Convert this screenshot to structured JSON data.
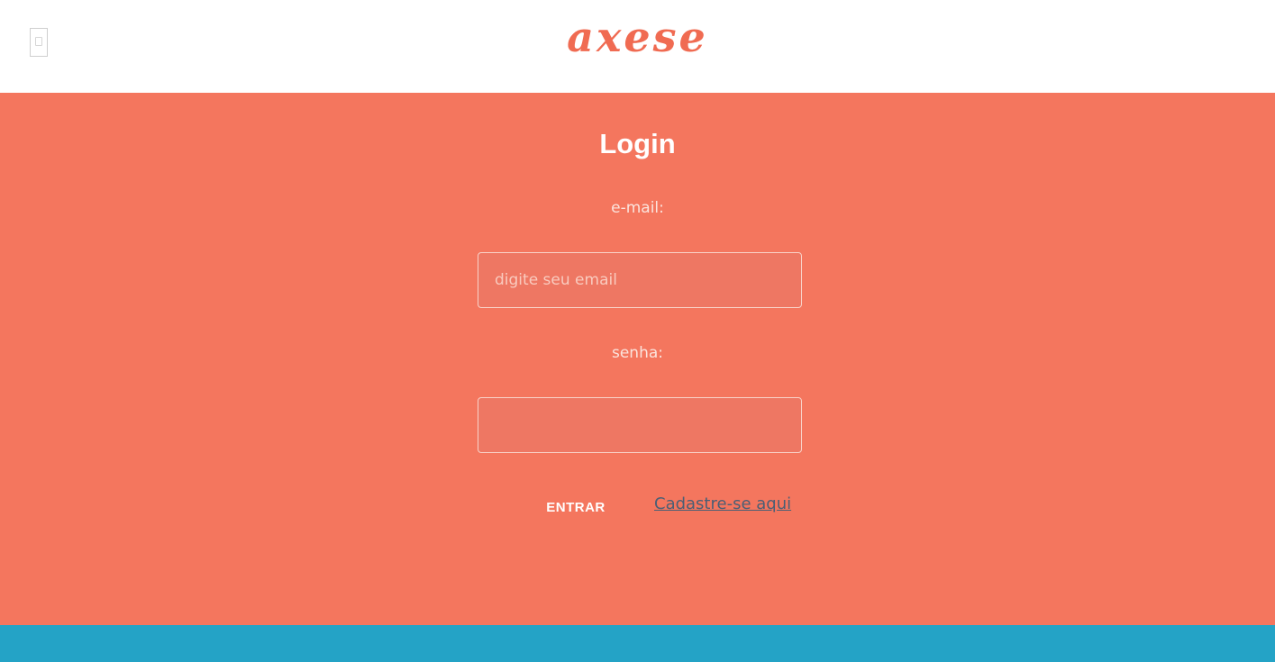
{
  "header": {
    "logo_text": "axese",
    "logo_color": "#f06b52",
    "image_icon": "broken-image-icon"
  },
  "login": {
    "title": "Login",
    "email_label": "e-mail:",
    "email_placeholder": "digite seu email",
    "email_value": "",
    "password_label": "senha:",
    "password_value": "",
    "submit_label": "ENTRAR",
    "register_link": "Cadastre-se aqui"
  },
  "colors": {
    "accent": "#f4765e",
    "footer": "#24a3c6",
    "link": "#4a5f75"
  }
}
